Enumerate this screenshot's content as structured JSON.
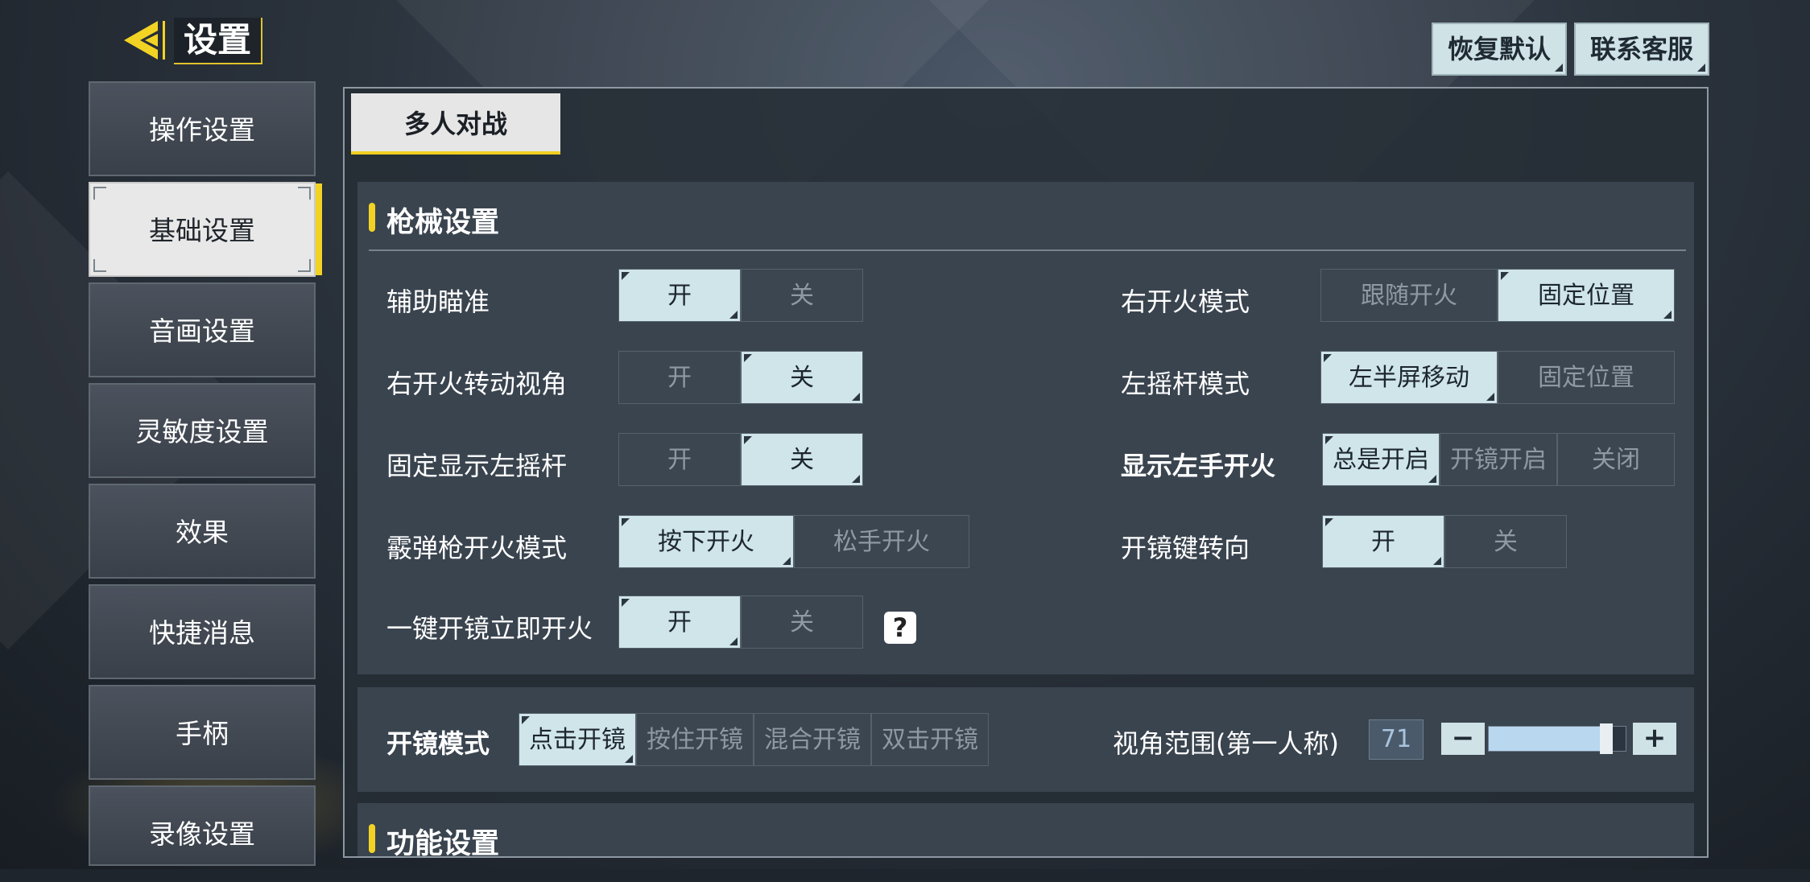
{
  "header": {
    "title": "设置",
    "restore_default": "恢复默认",
    "contact_support": "联系客服"
  },
  "sidebar": {
    "items": [
      {
        "label": "操作设置",
        "active": false
      },
      {
        "label": "基础设置",
        "active": true
      },
      {
        "label": "音画设置",
        "active": false
      },
      {
        "label": "灵敏度设置",
        "active": false
      },
      {
        "label": "效果",
        "active": false
      },
      {
        "label": "快捷消息",
        "active": false
      },
      {
        "label": "手柄",
        "active": false
      },
      {
        "label": "录像设置",
        "active": false
      }
    ]
  },
  "tabs": [
    {
      "label": "多人对战",
      "active": true
    }
  ],
  "weapon": {
    "title": "枪械设置",
    "aim_assist": {
      "label": "辅助瞄准",
      "options": [
        "开",
        "关"
      ],
      "selected": 0
    },
    "right_fire_rotate": {
      "label": "右开火转动视角",
      "options": [
        "开",
        "关"
      ],
      "selected": 1
    },
    "fixed_left_stick": {
      "label": "固定显示左摇杆",
      "options": [
        "开",
        "关"
      ],
      "selected": 1
    },
    "shotgun_fire": {
      "label": "霰弹枪开火模式",
      "options": [
        "按下开火",
        "松手开火"
      ],
      "selected": 0
    },
    "quick_scope_fire": {
      "label": "一键开镜立即开火",
      "options": [
        "开",
        "关"
      ],
      "selected": 0,
      "help": "?"
    },
    "right_fire_mode": {
      "label": "右开火模式",
      "options": [
        "跟随开火",
        "固定位置"
      ],
      "selected": 1
    },
    "left_stick_mode": {
      "label": "左摇杆模式",
      "options": [
        "左半屏移动",
        "固定位置"
      ],
      "selected": 0
    },
    "left_fire": {
      "label": "显示左手开火",
      "options": [
        "总是开启",
        "开镜开启",
        "关闭"
      ],
      "selected": 0
    },
    "scope_turn": {
      "label": "开镜键转向",
      "options": [
        "开",
        "关"
      ],
      "selected": 0
    }
  },
  "scope": {
    "label": "开镜模式",
    "options": [
      "点击开镜",
      "按住开镜",
      "混合开镜",
      "双击开镜"
    ],
    "selected": 0,
    "fov_label": "视角范围(第一人称)",
    "fov_value": "71",
    "fov_fraction": 0.86,
    "minus": "−",
    "plus": "+"
  },
  "function": {
    "title": "功能设置"
  }
}
